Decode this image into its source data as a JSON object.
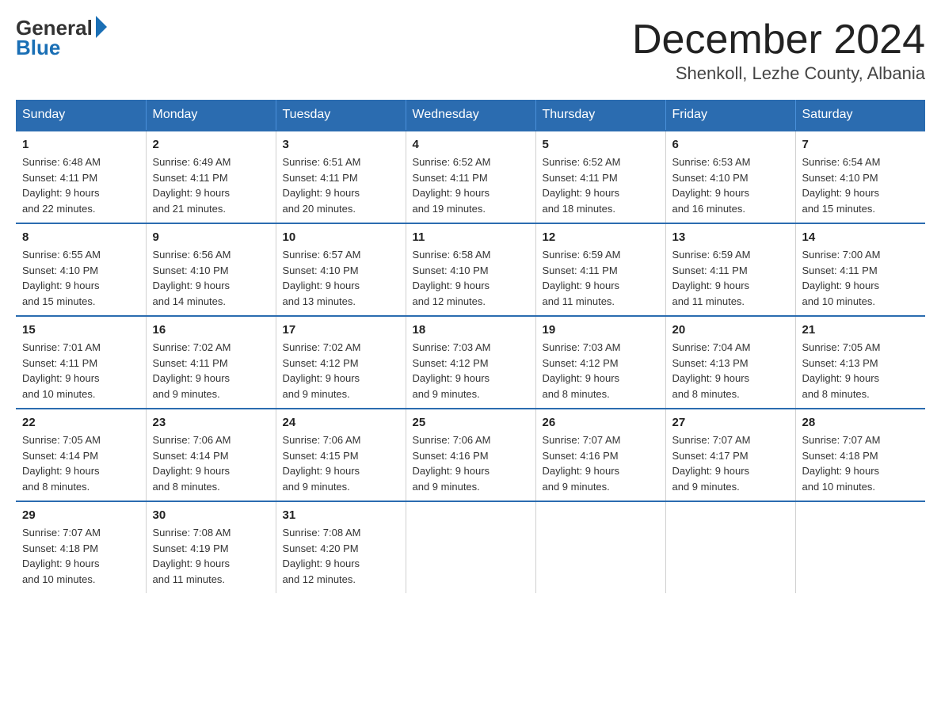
{
  "logo": {
    "general": "General",
    "blue": "Blue"
  },
  "title": {
    "month_year": "December 2024",
    "location": "Shenkoll, Lezhe County, Albania"
  },
  "headers": [
    "Sunday",
    "Monday",
    "Tuesday",
    "Wednesday",
    "Thursday",
    "Friday",
    "Saturday"
  ],
  "weeks": [
    [
      {
        "day": "1",
        "sunrise": "6:48 AM",
        "sunset": "4:11 PM",
        "daylight": "9 hours and 22 minutes."
      },
      {
        "day": "2",
        "sunrise": "6:49 AM",
        "sunset": "4:11 PM",
        "daylight": "9 hours and 21 minutes."
      },
      {
        "day": "3",
        "sunrise": "6:51 AM",
        "sunset": "4:11 PM",
        "daylight": "9 hours and 20 minutes."
      },
      {
        "day": "4",
        "sunrise": "6:52 AM",
        "sunset": "4:11 PM",
        "daylight": "9 hours and 19 minutes."
      },
      {
        "day": "5",
        "sunrise": "6:52 AM",
        "sunset": "4:11 PM",
        "daylight": "9 hours and 18 minutes."
      },
      {
        "day": "6",
        "sunrise": "6:53 AM",
        "sunset": "4:10 PM",
        "daylight": "9 hours and 16 minutes."
      },
      {
        "day": "7",
        "sunrise": "6:54 AM",
        "sunset": "4:10 PM",
        "daylight": "9 hours and 15 minutes."
      }
    ],
    [
      {
        "day": "8",
        "sunrise": "6:55 AM",
        "sunset": "4:10 PM",
        "daylight": "9 hours and 15 minutes."
      },
      {
        "day": "9",
        "sunrise": "6:56 AM",
        "sunset": "4:10 PM",
        "daylight": "9 hours and 14 minutes."
      },
      {
        "day": "10",
        "sunrise": "6:57 AM",
        "sunset": "4:10 PM",
        "daylight": "9 hours and 13 minutes."
      },
      {
        "day": "11",
        "sunrise": "6:58 AM",
        "sunset": "4:10 PM",
        "daylight": "9 hours and 12 minutes."
      },
      {
        "day": "12",
        "sunrise": "6:59 AM",
        "sunset": "4:11 PM",
        "daylight": "9 hours and 11 minutes."
      },
      {
        "day": "13",
        "sunrise": "6:59 AM",
        "sunset": "4:11 PM",
        "daylight": "9 hours and 11 minutes."
      },
      {
        "day": "14",
        "sunrise": "7:00 AM",
        "sunset": "4:11 PM",
        "daylight": "9 hours and 10 minutes."
      }
    ],
    [
      {
        "day": "15",
        "sunrise": "7:01 AM",
        "sunset": "4:11 PM",
        "daylight": "9 hours and 10 minutes."
      },
      {
        "day": "16",
        "sunrise": "7:02 AM",
        "sunset": "4:11 PM",
        "daylight": "9 hours and 9 minutes."
      },
      {
        "day": "17",
        "sunrise": "7:02 AM",
        "sunset": "4:12 PM",
        "daylight": "9 hours and 9 minutes."
      },
      {
        "day": "18",
        "sunrise": "7:03 AM",
        "sunset": "4:12 PM",
        "daylight": "9 hours and 9 minutes."
      },
      {
        "day": "19",
        "sunrise": "7:03 AM",
        "sunset": "4:12 PM",
        "daylight": "9 hours and 8 minutes."
      },
      {
        "day": "20",
        "sunrise": "7:04 AM",
        "sunset": "4:13 PM",
        "daylight": "9 hours and 8 minutes."
      },
      {
        "day": "21",
        "sunrise": "7:05 AM",
        "sunset": "4:13 PM",
        "daylight": "9 hours and 8 minutes."
      }
    ],
    [
      {
        "day": "22",
        "sunrise": "7:05 AM",
        "sunset": "4:14 PM",
        "daylight": "9 hours and 8 minutes."
      },
      {
        "day": "23",
        "sunrise": "7:06 AM",
        "sunset": "4:14 PM",
        "daylight": "9 hours and 8 minutes."
      },
      {
        "day": "24",
        "sunrise": "7:06 AM",
        "sunset": "4:15 PM",
        "daylight": "9 hours and 9 minutes."
      },
      {
        "day": "25",
        "sunrise": "7:06 AM",
        "sunset": "4:16 PM",
        "daylight": "9 hours and 9 minutes."
      },
      {
        "day": "26",
        "sunrise": "7:07 AM",
        "sunset": "4:16 PM",
        "daylight": "9 hours and 9 minutes."
      },
      {
        "day": "27",
        "sunrise": "7:07 AM",
        "sunset": "4:17 PM",
        "daylight": "9 hours and 9 minutes."
      },
      {
        "day": "28",
        "sunrise": "7:07 AM",
        "sunset": "4:18 PM",
        "daylight": "9 hours and 10 minutes."
      }
    ],
    [
      {
        "day": "29",
        "sunrise": "7:07 AM",
        "sunset": "4:18 PM",
        "daylight": "9 hours and 10 minutes."
      },
      {
        "day": "30",
        "sunrise": "7:08 AM",
        "sunset": "4:19 PM",
        "daylight": "9 hours and 11 minutes."
      },
      {
        "day": "31",
        "sunrise": "7:08 AM",
        "sunset": "4:20 PM",
        "daylight": "9 hours and 12 minutes."
      },
      null,
      null,
      null,
      null
    ]
  ],
  "labels": {
    "sunrise": "Sunrise:",
    "sunset": "Sunset:",
    "daylight": "Daylight:"
  }
}
